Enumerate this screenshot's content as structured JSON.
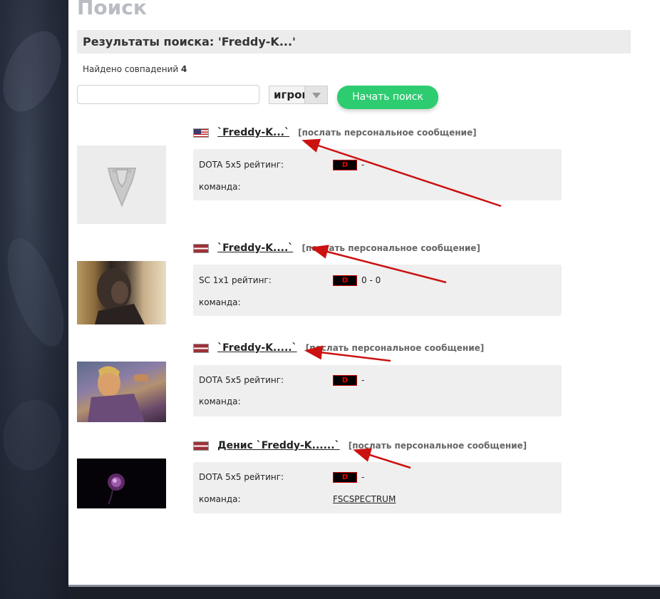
{
  "page": {
    "title": "Поиск"
  },
  "results_header": "Результаты поиска: 'Freddy-K...'",
  "found": {
    "label": "Найдено совпадений",
    "count": "4"
  },
  "search": {
    "value": "",
    "type_selected": "игроки",
    "button_label": "Начать поиск"
  },
  "results": [
    {
      "flag": "us-flag-icon",
      "nickname": "`Freddy-K...`",
      "message_link": "[послать персональное сообщение]",
      "rating_label": "DOTA 5x5 рейтинг:",
      "rank_badge": "D",
      "rating_value": "-",
      "team_label": "команда:",
      "team_value": ""
    },
    {
      "flag": "latvia-flag-icon",
      "nickname": "`Freddy-K....`",
      "message_link": "[послать персональное сообщение]",
      "rating_label": "SC 1x1 рейтинг:",
      "rank_badge": "D",
      "rating_value": "0 - 0",
      "team_label": "команда:",
      "team_value": ""
    },
    {
      "flag": "latvia-flag-icon",
      "nickname": "`Freddy-K.....`",
      "message_link": "[послать персональное сообщение]",
      "rating_label": "DOTA 5x5 рейтинг:",
      "rank_badge": "D",
      "rating_value": "-",
      "team_label": "команда:",
      "team_value": ""
    },
    {
      "flag": "latvia-flag-icon",
      "nickname": "Денис `Freddy-K......`",
      "message_link": "[послать персональное сообщение]",
      "rating_label": "DOTA 5x5 рейтинг:",
      "rank_badge": "D",
      "rating_value": "-",
      "team_label": "команда:",
      "team_value": "FSCSPECTRUM"
    }
  ],
  "colors": {
    "accent_green": "#2ecc71",
    "arrow_red": "#cc1111",
    "badge_red": "#ee0000"
  }
}
